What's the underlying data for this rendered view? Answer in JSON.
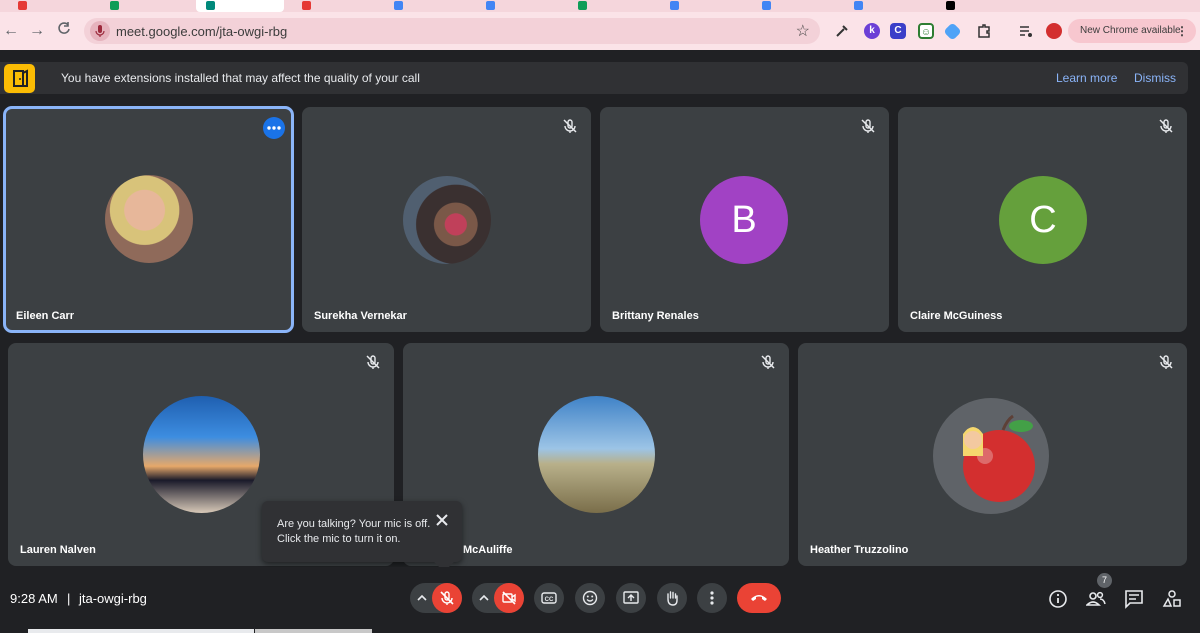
{
  "browser": {
    "url": "meet.google.com/jta-owgi-rbg",
    "new_chrome_label": "New Chrome available",
    "tabs": [
      {
        "favicon": "yt-icon",
        "color": "#e53935"
      },
      {
        "favicon": "sheets-icon",
        "color": "#0f9d58"
      },
      {
        "favicon": "meet-icon",
        "color": "#00897b"
      },
      {
        "favicon": "slides-icon",
        "color": "#e53935"
      },
      {
        "favicon": "docs-icon",
        "color": "#4285f4"
      },
      {
        "favicon": "docs-icon",
        "color": "#4285f4"
      },
      {
        "favicon": "sheets-icon",
        "color": "#0f9d58"
      },
      {
        "favicon": "docs-icon",
        "color": "#4285f4"
      },
      {
        "favicon": "docs-icon",
        "color": "#4285f4"
      },
      {
        "favicon": "docs-icon",
        "color": "#4285f4"
      },
      {
        "favicon": "x-icon",
        "color": "#000000"
      }
    ]
  },
  "banner": {
    "message": "You have extensions installed that may affect the quality of your call",
    "learn_more": "Learn more",
    "dismiss": "Dismiss"
  },
  "participants": [
    {
      "name": "Eileen Carr",
      "avatar": "photo-woman-blonde",
      "muted": false,
      "selected": true
    },
    {
      "name": "Surekha Vernekar",
      "avatar": "photo-couple",
      "muted": true
    },
    {
      "name": "Brittany Renales",
      "avatar_letter": "B",
      "avatar_color": "#a142c4",
      "muted": true
    },
    {
      "name": "Claire McGuiness",
      "avatar_letter": "C",
      "avatar_color": "#65a03c",
      "muted": true
    },
    {
      "name": "Lauren Nalven",
      "avatar": "photo-beach-sunset",
      "muted": true
    },
    {
      "name": "McAuliffe",
      "avatar": "photo-boardwalk",
      "muted": true
    },
    {
      "name": "Heather Truzzolino",
      "avatar": "bitmoji-apple",
      "muted": true
    }
  ],
  "tooltip": {
    "text": "Are you talking? Your mic is off. Click the mic to turn it on."
  },
  "meeting": {
    "time": "9:28 AM",
    "separator": "|",
    "code": "jta-owgi-rbg",
    "participant_count": "7"
  },
  "colors": {
    "accent_blue": "#8ab4f8",
    "end_call_red": "#ea4335",
    "warning_yellow": "#fbbc04"
  }
}
